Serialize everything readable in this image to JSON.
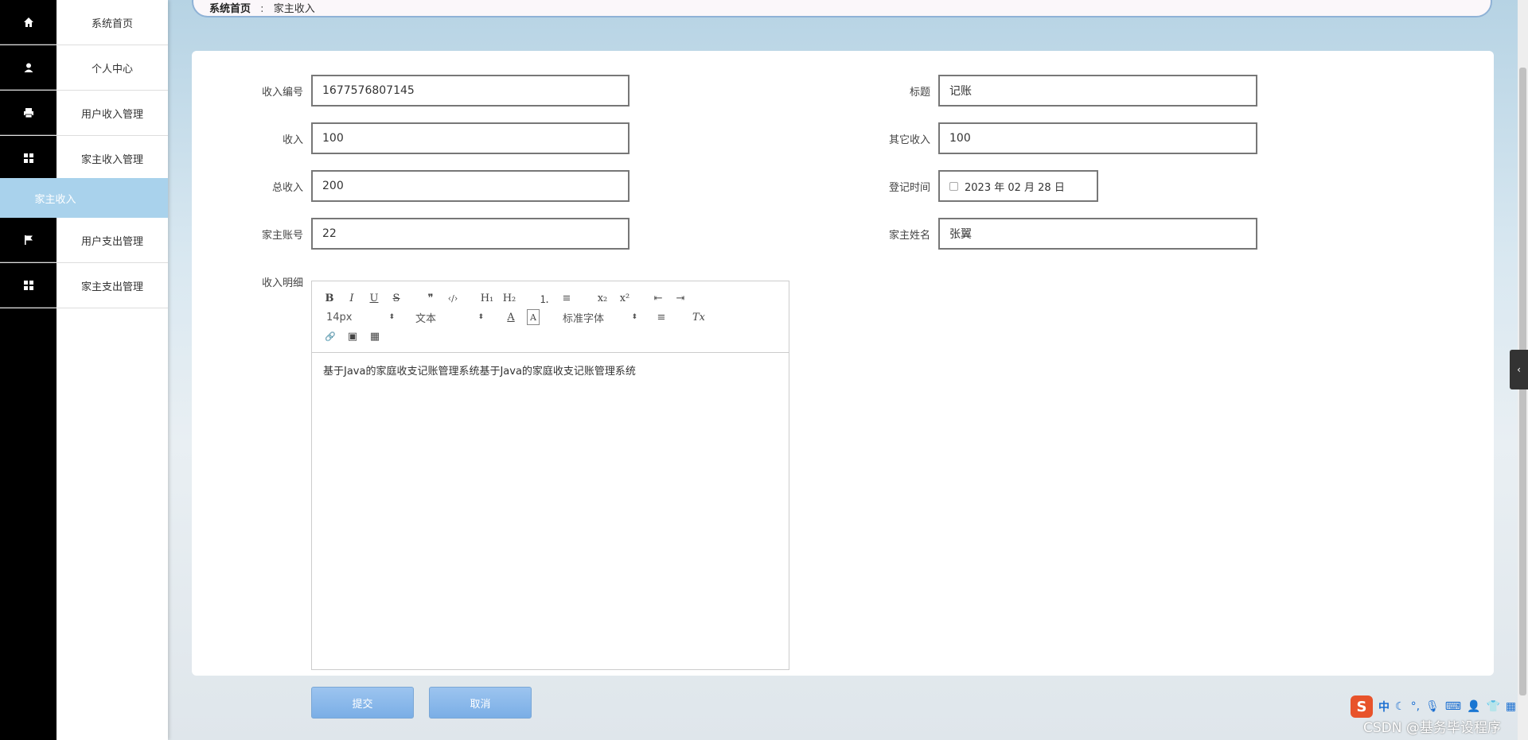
{
  "sidebar": {
    "items": [
      {
        "label": "系统首页",
        "icon": "home-icon"
      },
      {
        "label": "个人中心",
        "icon": "user-icon"
      },
      {
        "label": "用户收入管理",
        "icon": "printer-icon"
      },
      {
        "label": "家主收入管理",
        "icon": "grid-icon"
      },
      {
        "label": "用户支出管理",
        "icon": "flag-icon"
      },
      {
        "label": "家主支出管理",
        "icon": "grid-icon"
      }
    ],
    "active_sub": "家主收入"
  },
  "breadcrumb": {
    "home": "系统首页",
    "sep": ":",
    "current": "家主收入"
  },
  "form": {
    "income_no": {
      "label": "收入编号",
      "value": "1677576807145"
    },
    "title": {
      "label": "标题",
      "value": "记账"
    },
    "income": {
      "label": "收入",
      "value": "100"
    },
    "other_income": {
      "label": "其它收入",
      "value": "100"
    },
    "total_income": {
      "label": "总收入",
      "value": "200"
    },
    "reg_time": {
      "label": "登记时间",
      "value": "2023 年 02 月 28 日"
    },
    "owner_account": {
      "label": "家主账号",
      "value": "22"
    },
    "owner_name": {
      "label": "家主姓名",
      "value": "张翼"
    },
    "detail": {
      "label": "收入明细",
      "value": "基于Java的家庭收支记账管理系统基于Java的家庭收支记账管理系统"
    }
  },
  "editor": {
    "font_size": "14px",
    "text_type": "文本",
    "font_family": "标准字体",
    "buttons": {
      "bold": "B",
      "italic": "I",
      "underline": "U",
      "strike": "S",
      "quote": "❞",
      "code": "‹/›",
      "h1": "H₁",
      "h2": "H₂",
      "ol": "⒈",
      "ul": "≡",
      "sub": "x₂",
      "sup": "x²",
      "outdent": "⇤",
      "indent": "⇥",
      "color": "A",
      "bg": "A",
      "align": "≡",
      "clean": "Tx",
      "link": "🔗",
      "image": "▣",
      "video": "▦"
    }
  },
  "actions": {
    "submit": "提交",
    "cancel": "取消"
  },
  "overlay": {
    "watermark": "CSDN @基务毕设程序",
    "ime_logo": "S",
    "ime_lang": "中"
  }
}
